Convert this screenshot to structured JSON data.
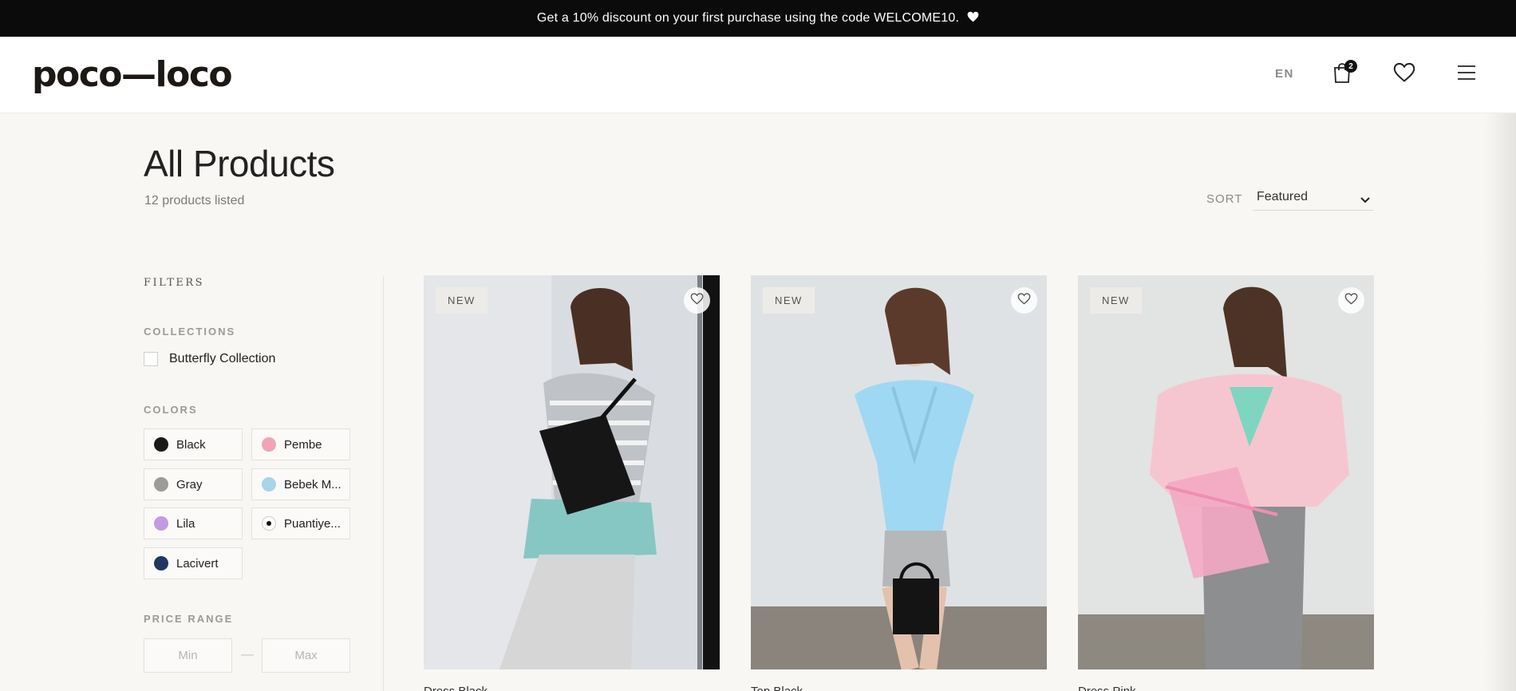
{
  "announcement": {
    "text": "Get a 10% discount on your first purchase using the code WELCOME10.",
    "icon": "heart-icon"
  },
  "header": {
    "logo": "poco—loco",
    "language": "EN",
    "cart_count": "2",
    "icons": [
      "shopping-bag-icon",
      "heart-icon",
      "hamburger-menu-icon"
    ]
  },
  "listing": {
    "title": "All Products",
    "count_text": "12 products listed",
    "sort_label": "SORT",
    "sort_value": "Featured"
  },
  "filters": {
    "title": "FILTERS",
    "collections_title": "COLLECTIONS",
    "collections": [
      {
        "label": "Butterfly Collection",
        "checked": false
      }
    ],
    "colors_title": "COLORS",
    "colors": [
      {
        "label": "Black",
        "swatch": "#1a1a1a"
      },
      {
        "label": "Pembe",
        "swatch": "#f2a3b5"
      },
      {
        "label": "Gray",
        "swatch": "#9c9c98"
      },
      {
        "label": "Bebek M...",
        "swatch": "#a9d4ea"
      },
      {
        "label": "Lila",
        "swatch": "#c39ae0"
      },
      {
        "label": "Puantiye...",
        "swatch": "#ffffff"
      },
      {
        "label": "Lacivert",
        "swatch": "#1f3762"
      }
    ],
    "price_title": "PRICE RANGE",
    "price_min_placeholder": "Min",
    "price_max_placeholder": "Max",
    "price_separator": "—"
  },
  "products": [
    {
      "badge": "NEW",
      "name": "Dress Black"
    },
    {
      "badge": "NEW",
      "name": "Top Black"
    },
    {
      "badge": "NEW",
      "name": "Dress Pink"
    }
  ],
  "colors": {
    "topbar_bg": "#0b0b0b",
    "page_bg": "#f8f7f4",
    "text": "#222222"
  }
}
